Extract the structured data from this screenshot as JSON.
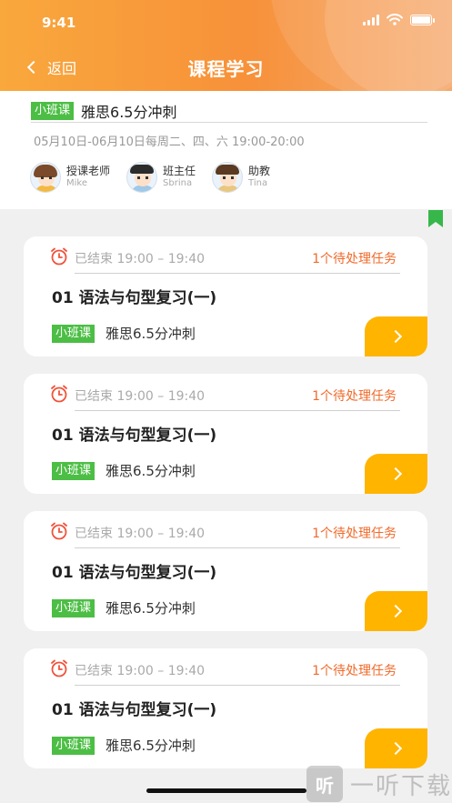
{
  "status_bar": {
    "time": "9:41",
    "icons": [
      "signal-icon",
      "wifi-icon",
      "battery-icon"
    ]
  },
  "header": {
    "back_label": "返回",
    "title": "课程学习"
  },
  "course": {
    "tag": "小班课",
    "title": "雅思6.5分冲刺",
    "schedule": "05月10日-06月10日每周二、四、六 19:00-20:00",
    "staff": [
      {
        "role": "授课老师",
        "name": "Mike"
      },
      {
        "role": "班主任",
        "name": "Sbrina"
      },
      {
        "role": "助教",
        "name": "Tina"
      }
    ]
  },
  "lessons": [
    {
      "status": "已结束 19:00 – 19:40",
      "task": "1个待处理任务",
      "title": "01 语法与句型复习(一)",
      "tag": "小班课",
      "course": "雅思6.5分冲刺"
    },
    {
      "status": "已结束 19:00 – 19:40",
      "task": "1个待处理任务",
      "title": "01 语法与句型复习(一)",
      "tag": "小班课",
      "course": "雅思6.5分冲刺"
    },
    {
      "status": "已结束 19:00 – 19:40",
      "task": "1个待处理任务",
      "title": "01 语法与句型复习(一)",
      "tag": "小班课",
      "course": "雅思6.5分冲刺"
    },
    {
      "status": "已结束 19:00 – 19:40",
      "task": "1个待处理任务",
      "title": "01 语法与句型复习(一)",
      "tag": "小班课",
      "course": "雅思6.5分冲刺"
    }
  ],
  "watermark": {
    "logo_glyph": "听",
    "text": "一听下载"
  },
  "colors": {
    "header_orange": "#f7913a",
    "tag_green": "#4cbe45",
    "task_red": "#f06a2a",
    "button_yellow": "#ffb400",
    "clock_red": "#f0533a"
  }
}
